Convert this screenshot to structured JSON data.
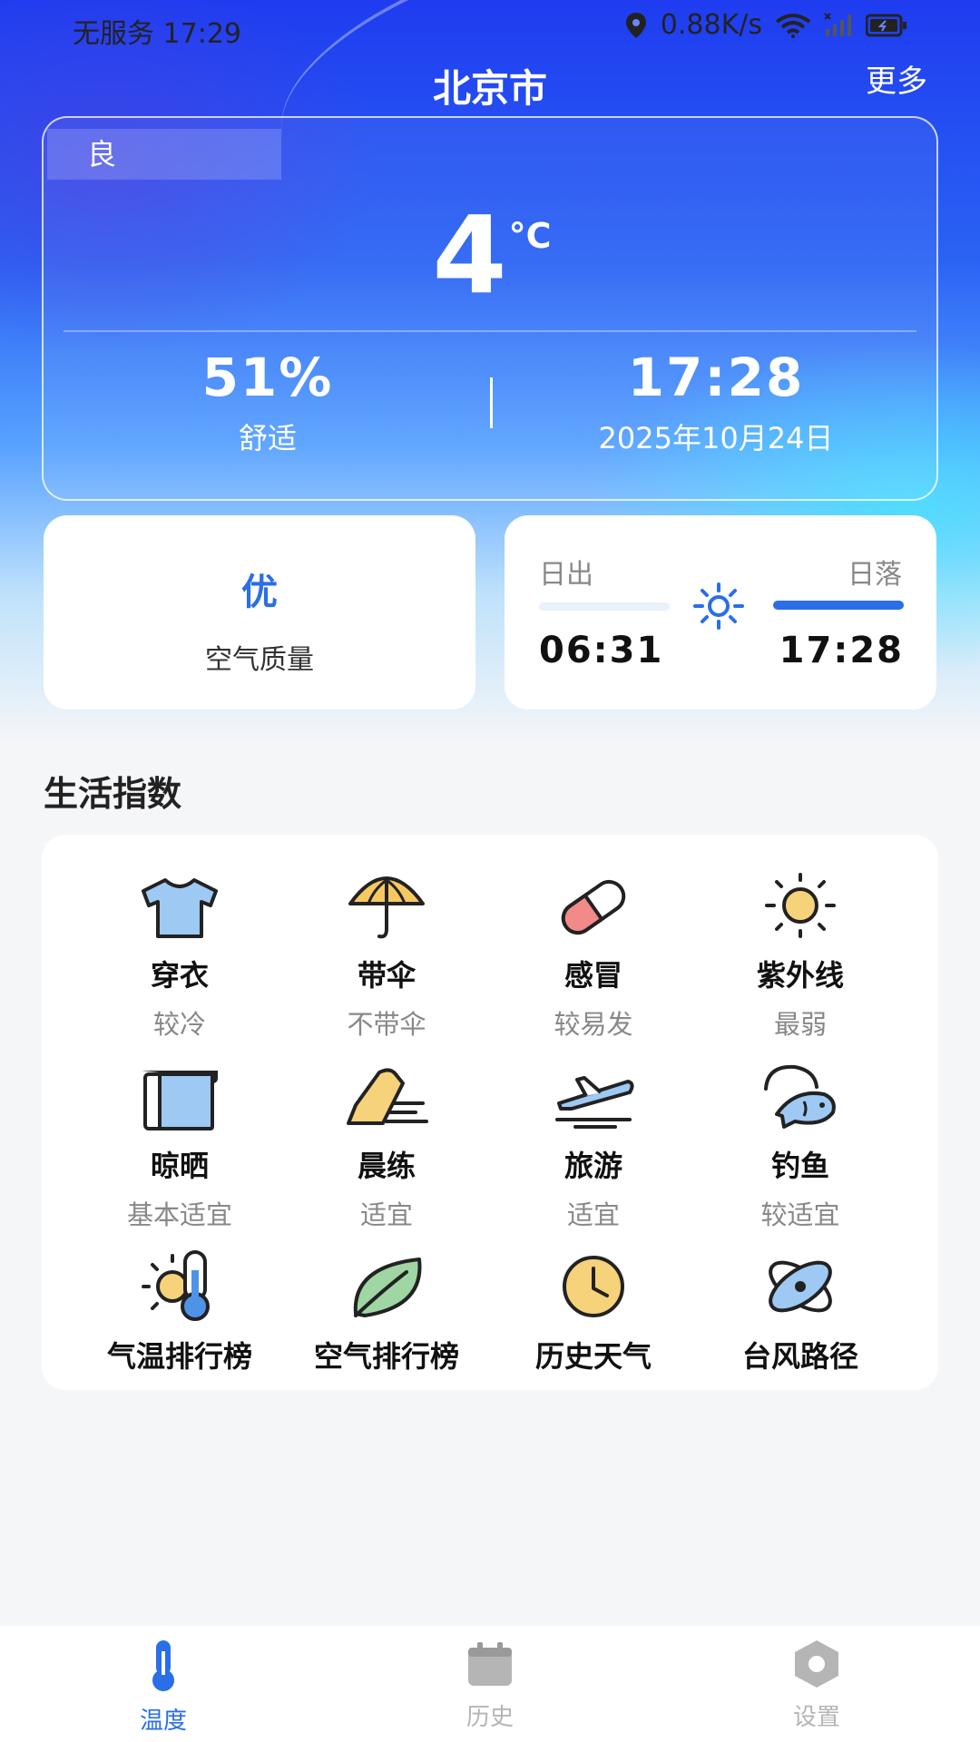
{
  "status_bar": {
    "carrier": "无服务",
    "time": "17:29",
    "net_speed": "0.88K/s"
  },
  "header": {
    "title": "北京市",
    "more_label": "更多"
  },
  "weather": {
    "quality_tag": "良",
    "temperature": "4",
    "unit": "°C",
    "humidity": "51%",
    "comfort": "舒适",
    "update_time": "17:28",
    "date": "2025年10月24日"
  },
  "air_quality": {
    "value": "优",
    "label": "空气质量",
    "value_color": "#2a6ee8"
  },
  "sun": {
    "sunrise_label": "日出",
    "sunset_label": "日落",
    "sunrise_time": "06:31",
    "sunset_time": "17:28"
  },
  "life_index": {
    "title": "生活指数",
    "items": [
      {
        "icon": "tshirt-icon",
        "name": "穿衣",
        "value": "较冷"
      },
      {
        "icon": "umbrella-icon",
        "name": "带伞",
        "value": "不带伞"
      },
      {
        "icon": "pill-icon",
        "name": "感冒",
        "value": "较易发"
      },
      {
        "icon": "sun-icon",
        "name": "紫外线",
        "value": "最弱"
      },
      {
        "icon": "towel-icon",
        "name": "晾晒",
        "value": "基本适宜"
      },
      {
        "icon": "sneaker-icon",
        "name": "晨练",
        "value": "适宜"
      },
      {
        "icon": "airplane-icon",
        "name": "旅游",
        "value": "适宜"
      },
      {
        "icon": "fishing-icon",
        "name": "钓鱼",
        "value": "较适宜"
      }
    ],
    "tools": [
      {
        "icon": "sun-thermometer-icon",
        "name": "气温排行榜"
      },
      {
        "icon": "leaf-icon",
        "name": "空气排行榜"
      },
      {
        "icon": "clock-icon",
        "name": "历史天气"
      },
      {
        "icon": "typhoon-icon",
        "name": "台风路径"
      }
    ]
  },
  "bottom_nav": {
    "items": [
      {
        "icon": "thermometer-icon",
        "label": "温度",
        "active": true
      },
      {
        "icon": "calendar-icon",
        "label": "历史",
        "active": false
      },
      {
        "icon": "hexagon-settings-icon",
        "label": "设置",
        "active": false
      }
    ],
    "active_color": "#2a6ee8",
    "inactive_color": "#b5b5b5"
  }
}
